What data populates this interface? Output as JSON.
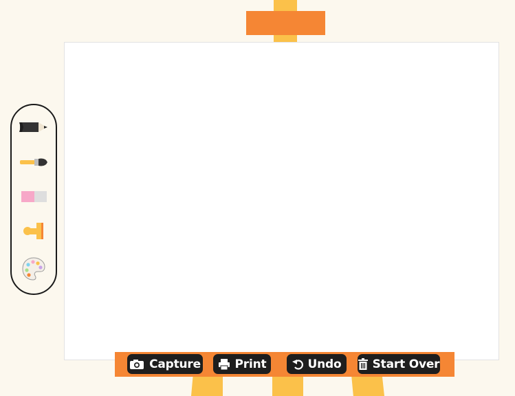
{
  "tools": [
    {
      "name": "pencil"
    },
    {
      "name": "paintbrush"
    },
    {
      "name": "eraser"
    },
    {
      "name": "stamp"
    },
    {
      "name": "palette"
    }
  ],
  "actions": {
    "capture": {
      "label": "Capture",
      "icon": "camera-icon"
    },
    "print": {
      "label": "Print",
      "icon": "printer-icon"
    },
    "undo": {
      "label": "Undo",
      "icon": "undo-icon"
    },
    "start_over": {
      "label": "Start Over",
      "icon": "trash-icon"
    }
  },
  "colors": {
    "background": "#fcf8ee",
    "easel_orange": "#f58634",
    "easel_wood": "#fbc14a",
    "button_dark": "#1e1e1e"
  }
}
